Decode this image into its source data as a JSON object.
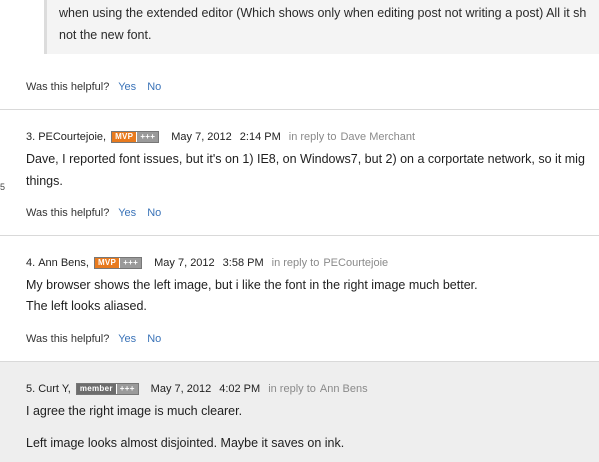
{
  "quote": {
    "lines": [
      "when using the extended editor (Which shows only when editing post not writing a post) All it sh",
      "not the new font."
    ]
  },
  "helpful": {
    "label": "Was this helpful?",
    "yes": "Yes",
    "no": "No"
  },
  "posts": [
    {
      "number": "3.",
      "author": "PECourtejoie,",
      "badge": {
        "type": "MVP",
        "level": "+++"
      },
      "date": "May 7, 2012",
      "time": "2:14 PM",
      "reply_prefix": "in reply to",
      "reply_to": "Dave Merchant",
      "lines": [
        "Dave, I reported font issues, but it's on 1) IE8, on Windows7, but 2) on a corportate network, so it mig",
        "things."
      ]
    },
    {
      "number": "4.",
      "author": "Ann Bens,",
      "badge": {
        "type": "MVP",
        "level": "+++"
      },
      "date": "May 7, 2012",
      "time": "3:58 PM",
      "reply_prefix": "in reply to",
      "reply_to": "PECourtejoie",
      "lines": [
        "My browser shows the left image, but i like the font in the right image much better.",
        "The left looks aliased."
      ]
    },
    {
      "number": "5.",
      "author": "Curt Y,",
      "badge": {
        "type": "member",
        "level": "+++"
      },
      "date": "May 7, 2012",
      "time": "4:02 PM",
      "reply_prefix": "in reply to",
      "reply_to": "Ann Bens",
      "lines": [
        "I agree the right image is much clearer.",
        "Left image looks almost disjointed.  Maybe it saves on ink."
      ]
    }
  ],
  "margin_mark": "5",
  "colors": {
    "link": "#3a73b8",
    "mvp": "#e87a1e",
    "member": "#6d6d6d",
    "muted": "#8a8a8a"
  }
}
